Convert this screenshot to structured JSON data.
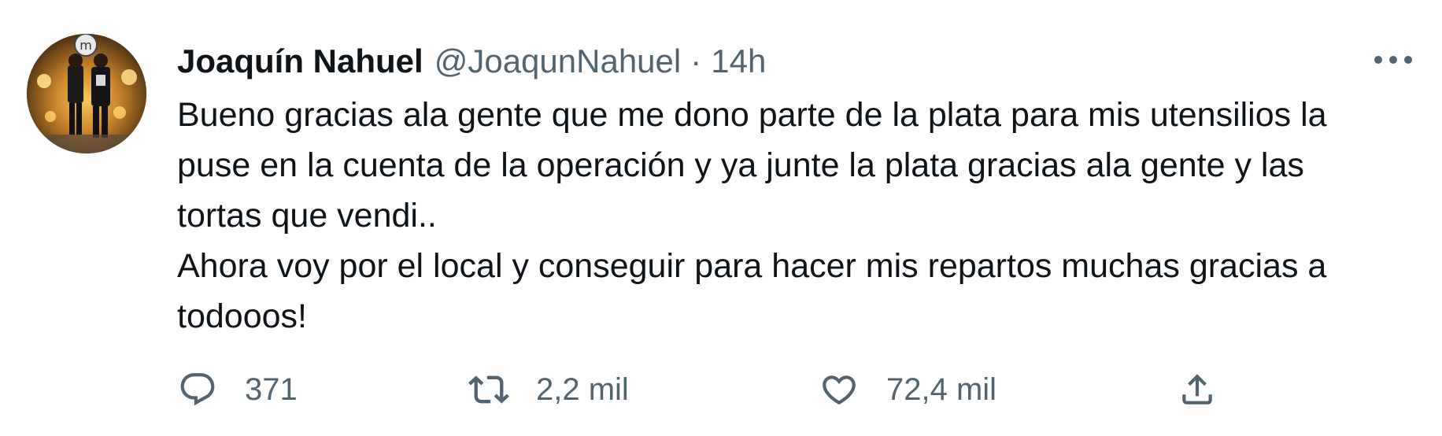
{
  "tweet": {
    "author": {
      "display_name": "Joaquín Nahuel",
      "handle": "@JoaqunNahuel"
    },
    "separator": "·",
    "timestamp": "14h",
    "text_lines": [
      "Bueno gracias ala gente que me dono parte de la plata para mis utensilios la",
      "puse en la cuenta de la operación y ya junte la plata gracias ala gente y las",
      "tortas que vendi..",
      "Ahora voy por el local y conseguir para hacer mis repartos muchas gracias a",
      "todooos!"
    ],
    "actions": {
      "reply_count": "371",
      "retweet_count": "2,2 mil",
      "like_count": "72,4 mil"
    },
    "icons": {
      "reply": "comment-bubble-icon",
      "retweet": "retweet-arrows-icon",
      "like": "heart-icon",
      "share": "share-upload-icon",
      "more": "more-horizontal-icon"
    },
    "colors": {
      "primary_text": "#0f1419",
      "secondary_text": "#536471",
      "background": "#ffffff"
    }
  }
}
